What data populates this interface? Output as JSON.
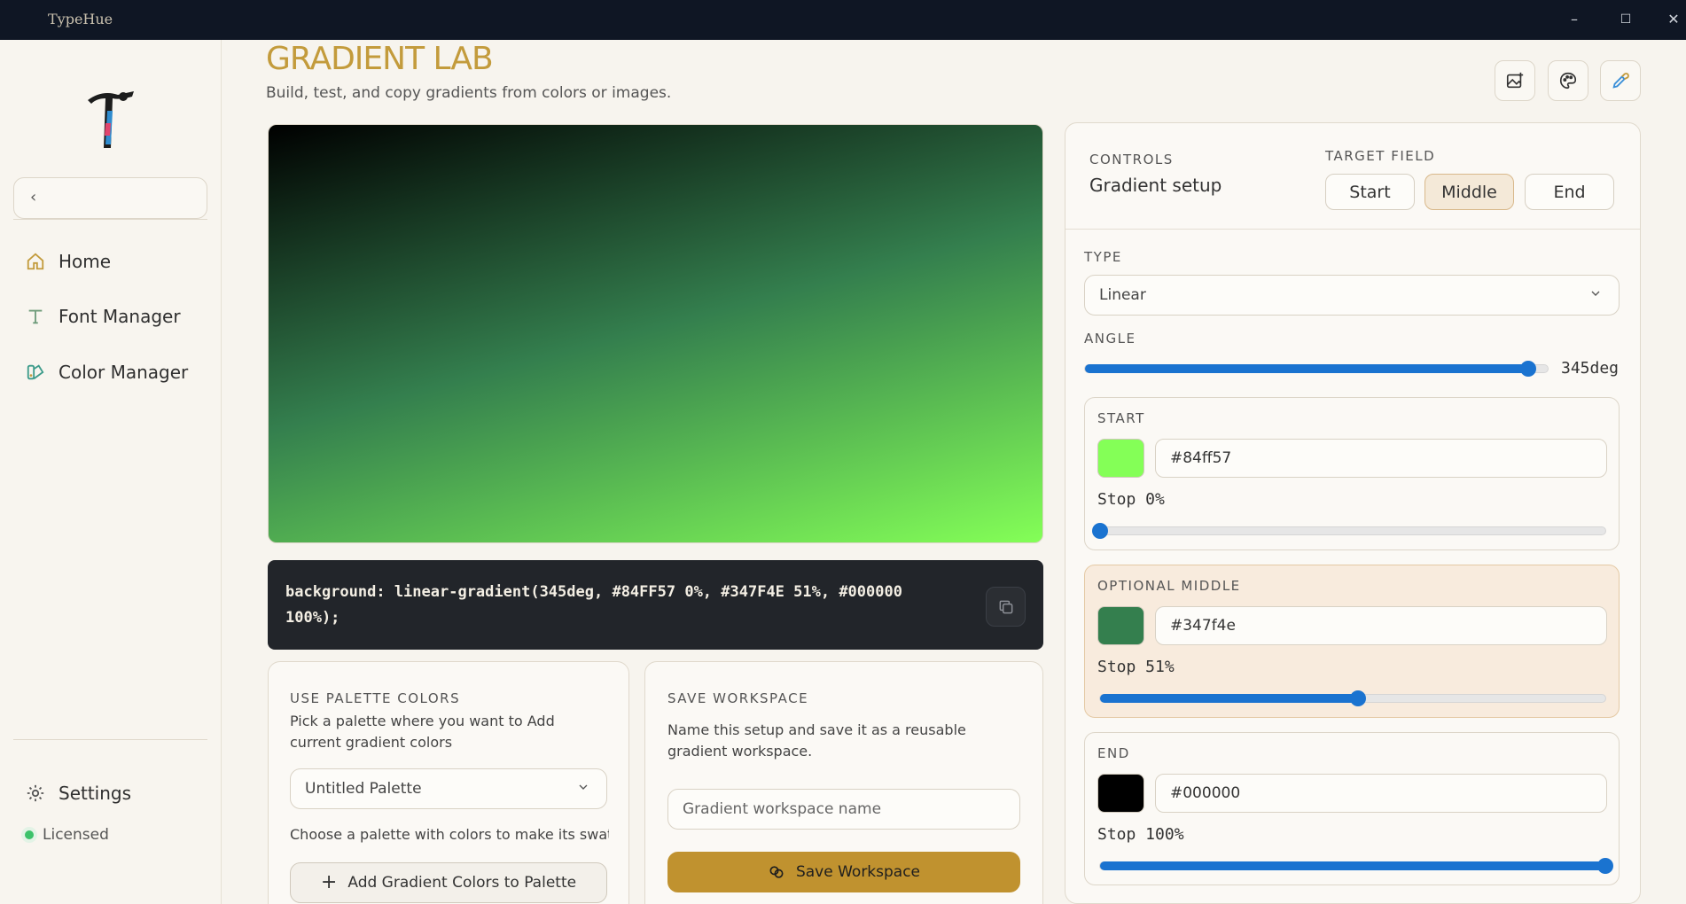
{
  "app": {
    "name": "TypeHue"
  },
  "window_controls": {
    "minimize": "–",
    "maximize": "☐",
    "close": "✕"
  },
  "sidebar": {
    "collapse_glyph": "‹",
    "items": [
      {
        "label": "Home",
        "icon": "home-icon"
      },
      {
        "label": "Font Manager",
        "icon": "type-icon"
      },
      {
        "label": "Color Manager",
        "icon": "palette-book-icon"
      }
    ],
    "settings": {
      "label": "Settings",
      "icon": "gear-icon"
    },
    "license": {
      "label": "Licensed"
    }
  },
  "header": {
    "title": "GRADIENT LAB",
    "subtitle": "Build, test, and copy gradients from colors or images.",
    "actions": [
      "image-add-icon",
      "palette-icon",
      "eyedropper-icon"
    ]
  },
  "code": {
    "text": "background: linear-gradient(345deg, #84FF57 0%, #347F4E 51%, #000000 100%);"
  },
  "palette_card": {
    "label": "USE PALETTE COLORS",
    "description": "Pick a palette where you want to Add current gradient colors",
    "selected_palette": "Untitled Palette",
    "hint": "Choose a palette with colors to make its swatc",
    "add_button": "Add Gradient Colors to Palette"
  },
  "workspace_card": {
    "label": "SAVE WORKSPACE",
    "description": "Name this setup and save it as a reusable gradient workspace.",
    "name_placeholder": "Gradient workspace name",
    "save_button": "Save Workspace"
  },
  "controls": {
    "label": "CONTROLS",
    "title": "Gradient setup",
    "target_label": "TARGET FIELD",
    "targets": [
      "Start",
      "Middle",
      "End"
    ],
    "active_target": "Middle",
    "type_label": "TYPE",
    "type_value": "Linear",
    "angle_label": "ANGLE",
    "angle_value": "345deg",
    "angle_fraction": 0.958,
    "start": {
      "label": "START",
      "hex": "#84ff57",
      "color": "#84ff57",
      "stop_text": "Stop 0%",
      "stop": 0
    },
    "middle": {
      "label": "OPTIONAL MIDDLE",
      "hex": "#347f4e",
      "color": "#347f4e",
      "stop_text": "Stop 51%",
      "stop": 51
    },
    "end": {
      "label": "END",
      "hex": "#000000",
      "color": "#000000",
      "stop_text": "Stop 100%",
      "stop": 100
    }
  },
  "colors": {
    "accent": "#c39b3c",
    "button_gold": "#c0922f",
    "slider": "#1a73d0"
  }
}
